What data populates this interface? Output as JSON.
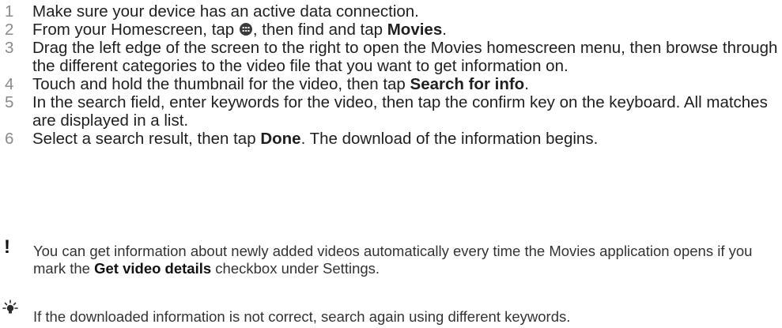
{
  "steps": [
    {
      "num": "1",
      "pre": "Make sure your device has an active data connection."
    },
    {
      "num": "2",
      "pre": "From your Homescreen, tap ",
      "icon": "apps-icon",
      "mid": ", then find and tap ",
      "bold": "Movies",
      "post": "."
    },
    {
      "num": "3",
      "pre": "Drag the left edge of the screen to the right to open the Movies homescreen menu, then browse through the different categories to the video file that you want to get information on."
    },
    {
      "num": "4",
      "pre": "Touch and hold the thumbnail for the video, then tap ",
      "bold": "Search for info",
      "post": "."
    },
    {
      "num": "5",
      "pre": "In the search field, enter keywords for the video, then tap the confirm key on the keyboard. All matches are displayed in a list."
    },
    {
      "num": "6",
      "pre": "Select a search result, then tap ",
      "bold": "Done",
      "post": ". The download of the information begins."
    }
  ],
  "important_note": {
    "icon": "exclamation-icon",
    "pre": "You can get information about newly added videos automatically every time the Movies application opens if you mark the ",
    "bold": "Get video details",
    "post": " checkbox under Settings."
  },
  "tip_note": {
    "icon": "lightbulb-icon",
    "text": "If the downloaded information is not correct, search again using different keywords."
  }
}
